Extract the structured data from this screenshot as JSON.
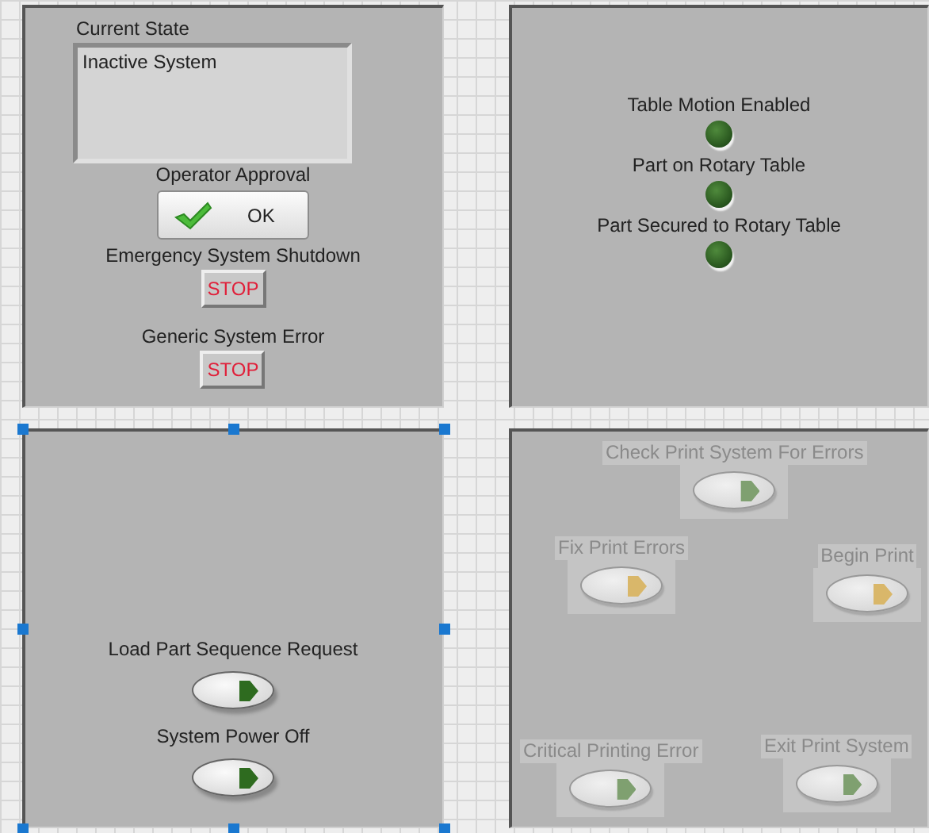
{
  "panels": [
    {
      "selected": false,
      "controls": [
        {
          "kind": "string",
          "label": "Current State",
          "value": "Inactive System"
        },
        {
          "kind": "ok_button",
          "label": "Operator Approval",
          "text": "OK"
        },
        {
          "kind": "stop_button",
          "label": "Emergency System Shutdown",
          "text": "STOP"
        },
        {
          "kind": "stop_button",
          "label": "Generic System Error",
          "text": "STOP"
        }
      ]
    },
    {
      "selected": false,
      "controls": [
        {
          "kind": "led",
          "label": "Table Motion Enabled",
          "on": false
        },
        {
          "kind": "led",
          "label": "Part on Rotary Table",
          "on": false
        },
        {
          "kind": "led",
          "label": "Part Secured to Rotary Table",
          "on": false
        }
      ]
    },
    {
      "selected": true,
      "controls": [
        {
          "kind": "switch",
          "label": "Load Part Sequence Request",
          "disabled": false,
          "color": "#2e6b1f"
        },
        {
          "kind": "switch",
          "label": "System Power Off",
          "disabled": false,
          "color": "#2e6b1f"
        }
      ]
    },
    {
      "selected": false,
      "controls": [
        {
          "kind": "switch",
          "label": "Check Print System For Errors",
          "disabled": true,
          "color": "#7fa070"
        },
        {
          "kind": "switch",
          "label": "Fix Print Errors",
          "disabled": true,
          "color": "#d9b76a"
        },
        {
          "kind": "switch",
          "label": "Begin Print",
          "disabled": true,
          "color": "#d9b76a"
        },
        {
          "kind": "switch",
          "label": "Critical Printing Error",
          "disabled": true,
          "color": "#7fa070"
        },
        {
          "kind": "switch",
          "label": "Exit Print System",
          "disabled": true,
          "color": "#7fa070"
        }
      ]
    }
  ]
}
